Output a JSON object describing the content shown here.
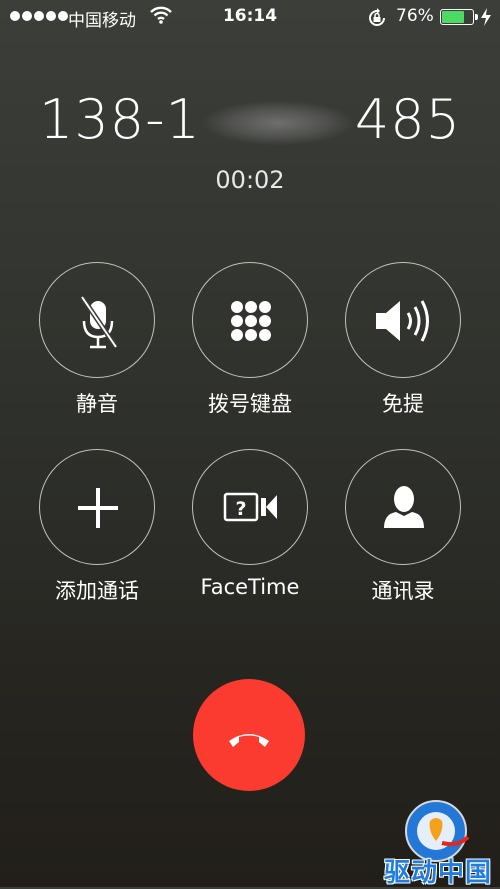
{
  "status_bar": {
    "carrier": "中国移动",
    "time": "16:14",
    "battery_percent": "76%",
    "battery_level": 0.76,
    "signal_dots": 5
  },
  "call": {
    "number_prefix": "138-1",
    "number_suffix": "485",
    "duration": "00:02"
  },
  "buttons": [
    {
      "label": "静音",
      "icon": "mute-microphone-icon"
    },
    {
      "label": "拨号键盘",
      "icon": "keypad-icon"
    },
    {
      "label": "免提",
      "icon": "speaker-icon"
    },
    {
      "label": "添加通话",
      "icon": "plus-icon"
    },
    {
      "label": "FaceTime",
      "icon": "facetime-icon"
    },
    {
      "label": "通讯录",
      "icon": "contact-icon"
    }
  ],
  "end_call": {
    "icon": "hang-up-icon",
    "color": "#fb3b30"
  },
  "watermark": {
    "text": "驱动中国"
  },
  "colors": {
    "battery": "#4cd964",
    "end_call": "#fb3b30",
    "watermark": "#1f7de0"
  }
}
